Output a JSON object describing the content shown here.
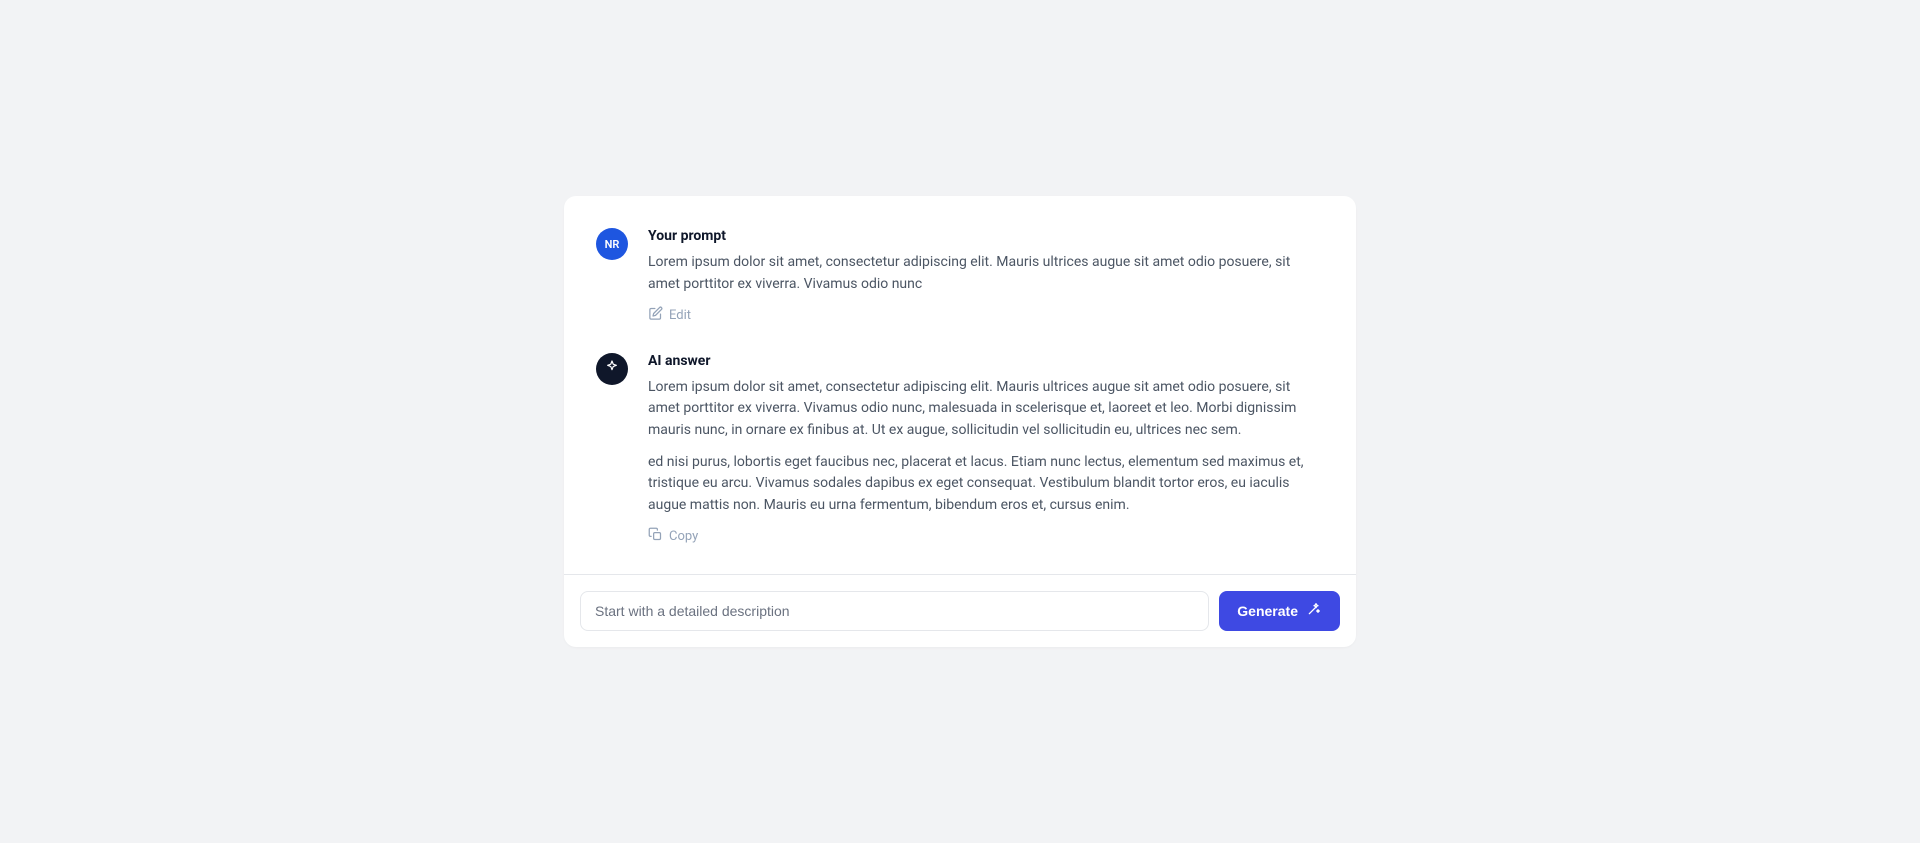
{
  "user_message": {
    "avatar_initials": "NR",
    "title": "Your prompt",
    "body": "Lorem ipsum dolor sit amet, consectetur adipiscing elit. Mauris ultrices augue sit amet odio posuere, sit amet porttitor ex viverra. Vivamus odio nunc",
    "edit_label": "Edit"
  },
  "ai_message": {
    "title": "AI answer",
    "body1": "Lorem ipsum dolor sit amet, consectetur adipiscing elit. Mauris ultrices augue sit amet odio posuere, sit amet porttitor ex viverra. Vivamus odio nunc, malesuada in scelerisque et, laoreet et leo. Morbi dignissim mauris nunc, in ornare ex finibus at. Ut ex augue, sollicitudin vel sollicitudin eu, ultrices nec sem.",
    "body2": "ed nisi purus, lobortis eget faucibus nec, placerat et lacus. Etiam nunc lectus, elementum sed maximus et, tristique eu arcu. Vivamus sodales dapibus ex eget consequat. Vestibulum blandit tortor eros, eu iaculis augue mattis non. Mauris eu urna fermentum, bibendum eros et, cursus enim.",
    "copy_label": "Copy"
  },
  "input": {
    "placeholder": "Start with a detailed description",
    "button_label": "Generate"
  }
}
